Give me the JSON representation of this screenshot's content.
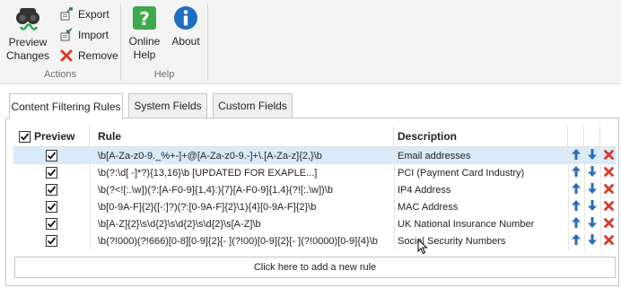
{
  "ribbon": {
    "actions": {
      "group_label": "Actions",
      "preview_label": "Preview\nChanges",
      "export_label": "Export",
      "import_label": "Import",
      "remove_label": "Remove"
    },
    "help": {
      "group_label": "Help",
      "online_help_label": "Online\nHelp",
      "about_label": "About"
    }
  },
  "tabs": [
    {
      "label": "Content Filtering Rules",
      "active": true
    },
    {
      "label": "System Fields",
      "active": false
    },
    {
      "label": "Custom Fields",
      "active": false
    }
  ],
  "grid": {
    "columns": {
      "preview": "Preview",
      "rule": "Rule",
      "description": "Description"
    },
    "header_preview_checked": true,
    "rows": [
      {
        "preview": true,
        "rule": "\\b[A-Za-z0-9._%+-]+@[A-Za-z0-9.-]+\\.[A-Za-z]{2,}\\b",
        "description": "Email addresses",
        "selected": true
      },
      {
        "preview": true,
        "rule": "\\b(?:\\d[ -]*?){13,16}\\b  [UPDATED FOR EXAPLE...]",
        "description": "PCI (Payment Card Industry)",
        "selected": false
      },
      {
        "preview": true,
        "rule": "\\b(?<![:.\\w])(?:[A-F0-9]{1,4}:){7}[A-F0-9]{1,4}(?![:.\\w])\\b",
        "description": "IP4 Address",
        "selected": false
      },
      {
        "preview": true,
        "rule": "\\b[0-9A-F]{2}([-:]?)(?:[0-9A-F]{2}\\1){4}[0-9A-F]{2}\\b",
        "description": "MAC Address",
        "selected": false
      },
      {
        "preview": true,
        "rule": "\\b[A-Z]{2}\\s\\d{2}\\s\\d{2}\\s\\d{2}\\s[A-Z]\\b",
        "description": "UK National Insurance Number",
        "selected": false
      },
      {
        "preview": true,
        "rule": "\\b(?!000)(?!666)[0-8][0-9]{2}[- ](?!00)[0-9]{2}[- ](?!0000)[0-9]{4}\\b",
        "description": "Social Security Numbers",
        "selected": false
      }
    ],
    "add_rule_label": "Click here to add a new rule"
  },
  "colors": {
    "accent_blue": "#2b6cb8",
    "delete_red": "#d9392b",
    "help_green": "#3daa4d",
    "about_blue": "#1f6fc0",
    "selected_row": "#d9ebf9"
  },
  "icons": {
    "preview": "binoculars-icon",
    "export": "export-icon",
    "import": "import-icon",
    "remove": "remove-x-icon",
    "online_help": "help-question-icon",
    "about": "info-icon",
    "move_up": "arrow-up-icon",
    "move_down": "arrow-down-icon",
    "delete": "delete-x-icon"
  }
}
